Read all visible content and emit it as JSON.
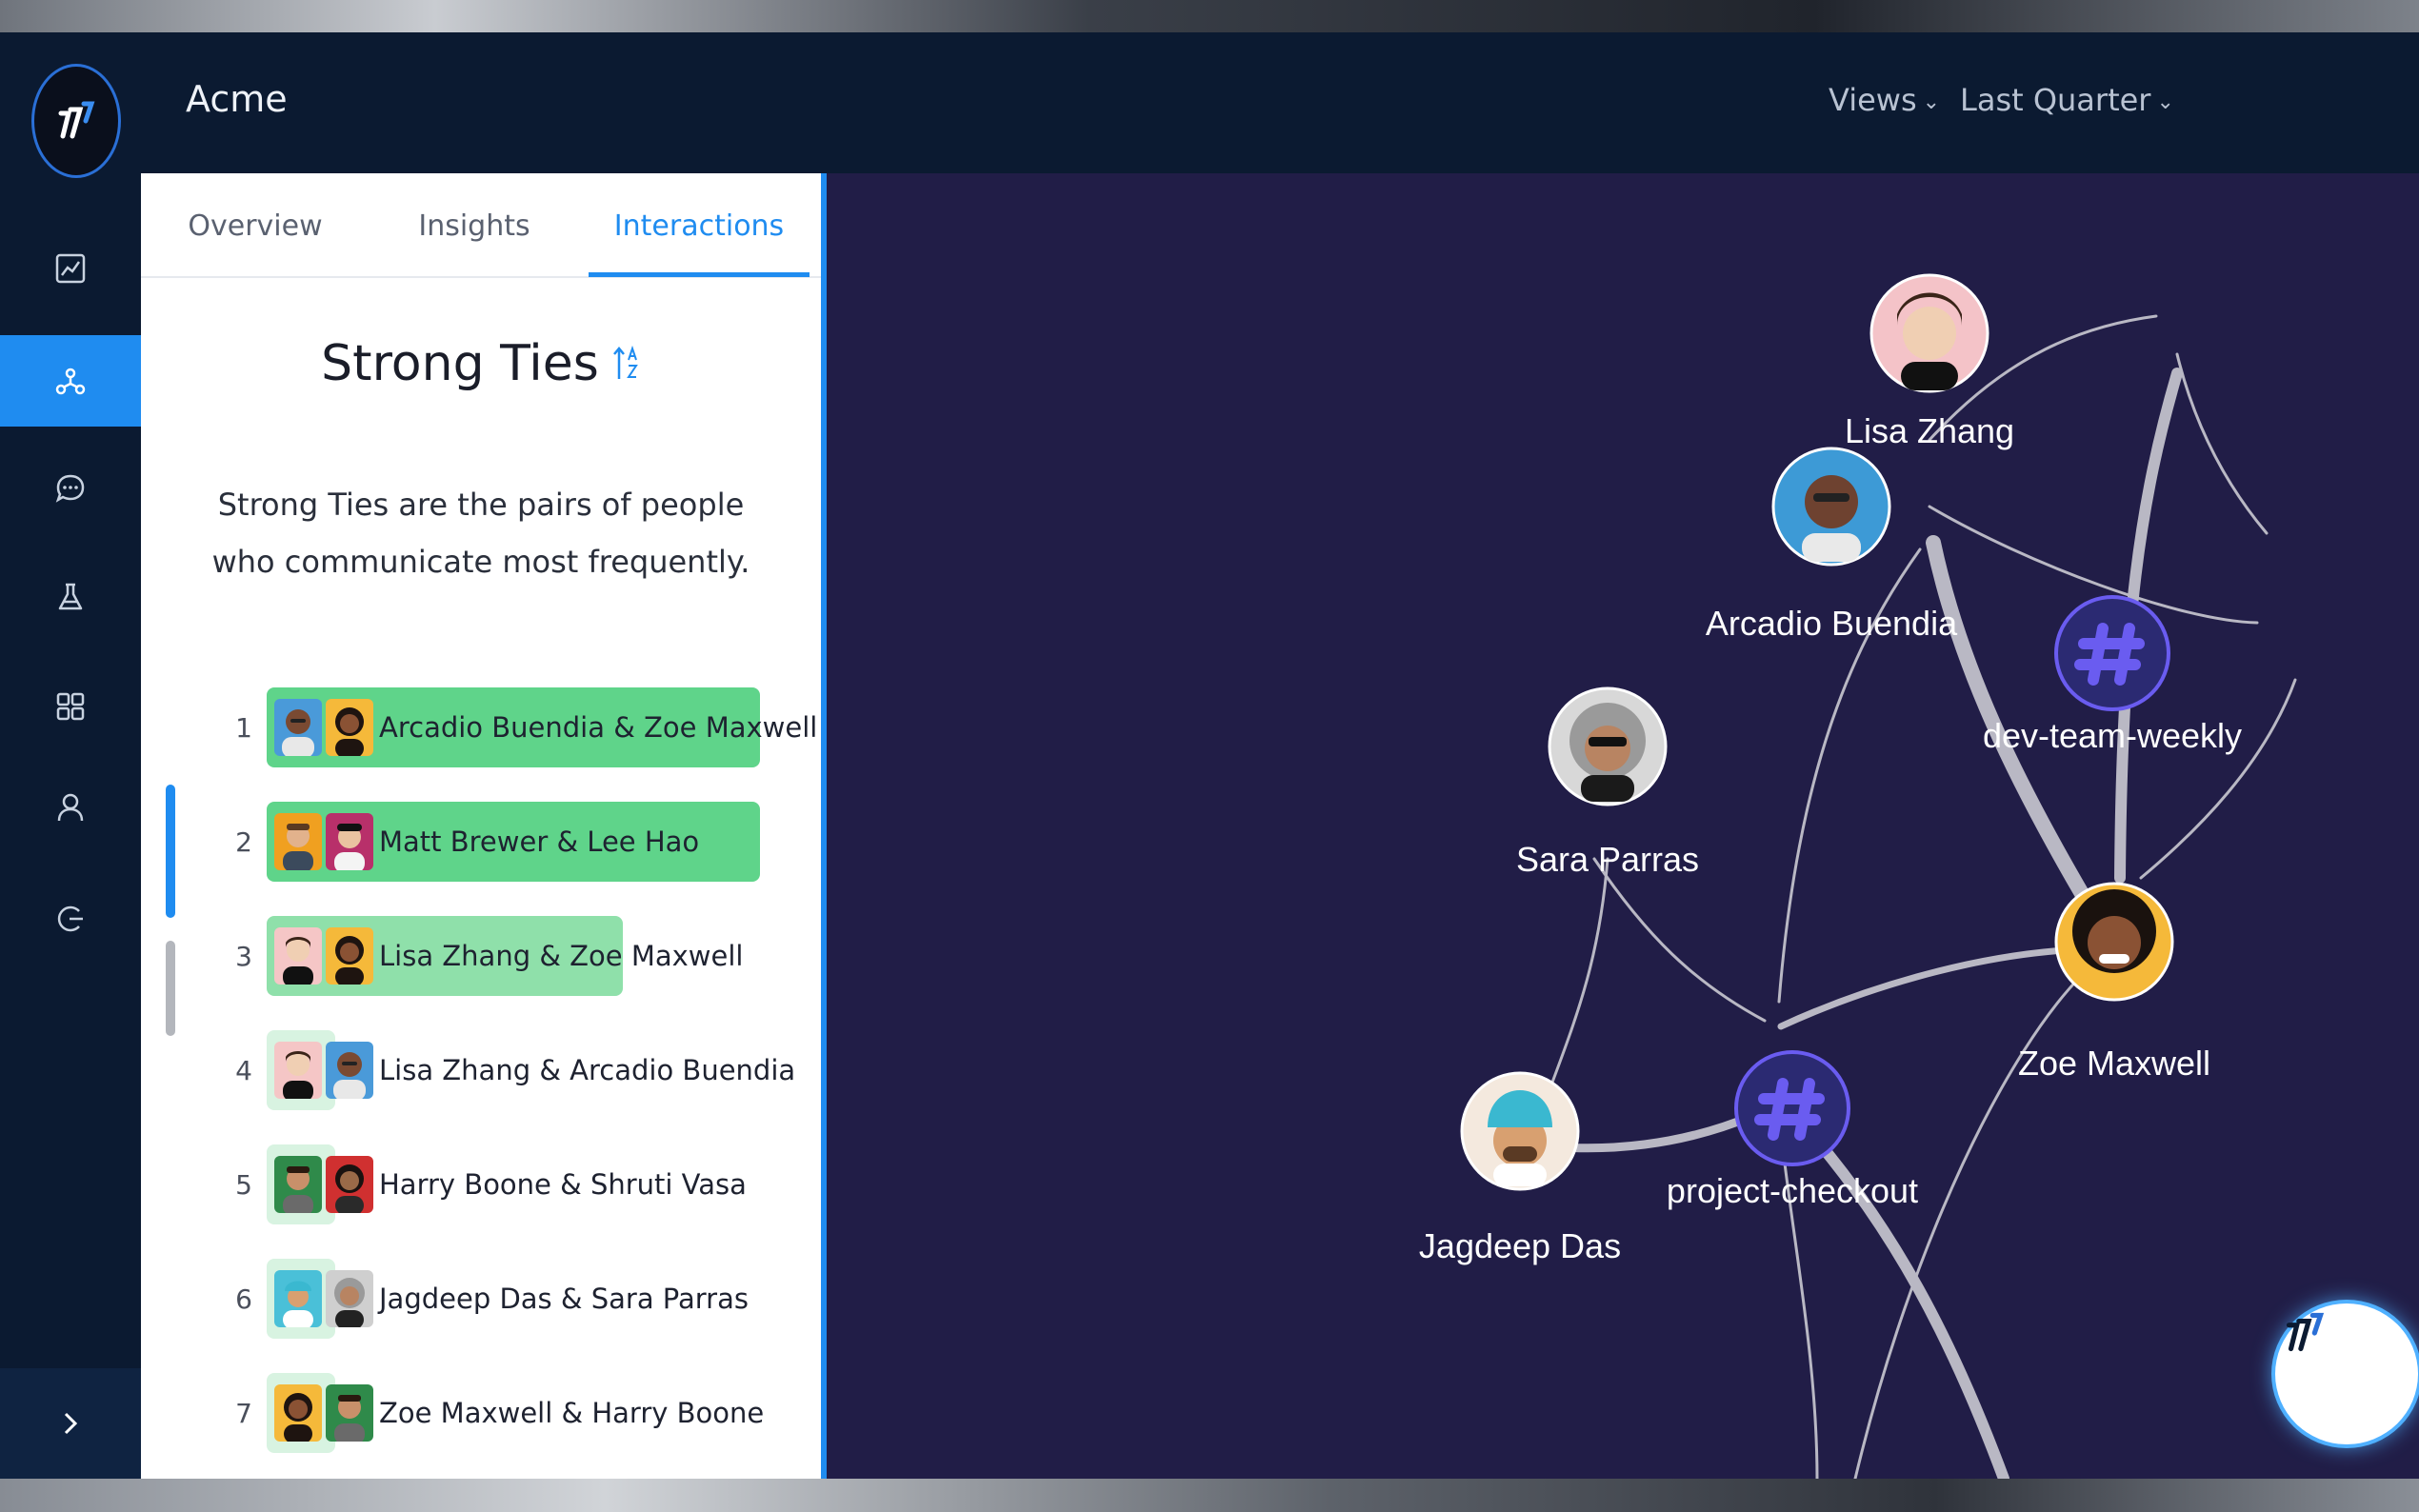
{
  "app": {
    "title": "Acme"
  },
  "topbar": {
    "views_label": "Views",
    "period_label": "Last Quarter",
    "chevron": "⌄"
  },
  "sidebar": {
    "items": [
      {
        "icon": "line-chart-icon",
        "active": false
      },
      {
        "icon": "network-icon",
        "active": true
      },
      {
        "icon": "chat-bubble-icon",
        "active": false
      },
      {
        "icon": "flask-icon",
        "active": false
      },
      {
        "icon": "grid-icon",
        "active": false
      },
      {
        "icon": "person-icon",
        "active": false
      },
      {
        "icon": "logout-icon",
        "active": false
      }
    ],
    "expand_icon": "chevron-right-icon"
  },
  "panel": {
    "tabs": [
      {
        "label": "Overview",
        "active": false
      },
      {
        "label": "Insights",
        "active": false
      },
      {
        "label": "Interactions",
        "active": true
      }
    ],
    "title": "Strong Ties",
    "description": "Strong Ties are the pairs of people who communicate most frequently.",
    "ties": [
      {
        "rank": "1",
        "label": "Arcadio Buendia & Zoe Maxwell",
        "strength": 1.0
      },
      {
        "rank": "2",
        "label": "Matt Brewer & Lee Hao",
        "strength": 1.0
      },
      {
        "rank": "3",
        "label": "Lisa Zhang & Zoe Maxwell",
        "strength": 0.72
      },
      {
        "rank": "4",
        "label": "Lisa Zhang & Arcadio Buendia",
        "strength": 0.14
      },
      {
        "rank": "5",
        "label": "Harry Boone & Shruti Vasa",
        "strength": 0.14
      },
      {
        "rank": "6",
        "label": "Jagdeep Das & Sara Parras",
        "strength": 0.14
      },
      {
        "rank": "7",
        "label": "Zoe Maxwell & Harry Boone",
        "strength": 0.14
      }
    ]
  },
  "graph": {
    "nodes": [
      {
        "id": "lisa",
        "label": "Lisa Zhang",
        "kind": "person"
      },
      {
        "id": "arcadio",
        "label": "Arcadio Buendia",
        "kind": "person"
      },
      {
        "id": "devteam",
        "label": "dev-team-weekly",
        "kind": "channel"
      },
      {
        "id": "sara",
        "label": "Sara Parras",
        "kind": "person"
      },
      {
        "id": "zoe",
        "label": "Zoe Maxwell",
        "kind": "person"
      },
      {
        "id": "checkout",
        "label": "project-checkout",
        "kind": "channel"
      },
      {
        "id": "jagdeep",
        "label": "Jagdeep Das",
        "kind": "person"
      }
    ]
  },
  "colors": {
    "accent": "#1f8cf0",
    "tie_strong": "#5fd48a",
    "tie_medium": "#8fe0aa",
    "tie_weak": "#d8f3e1",
    "graph_bg": "#211d47",
    "channel_node": "#2b2a72",
    "channel_glyph": "#6a5cf0"
  }
}
